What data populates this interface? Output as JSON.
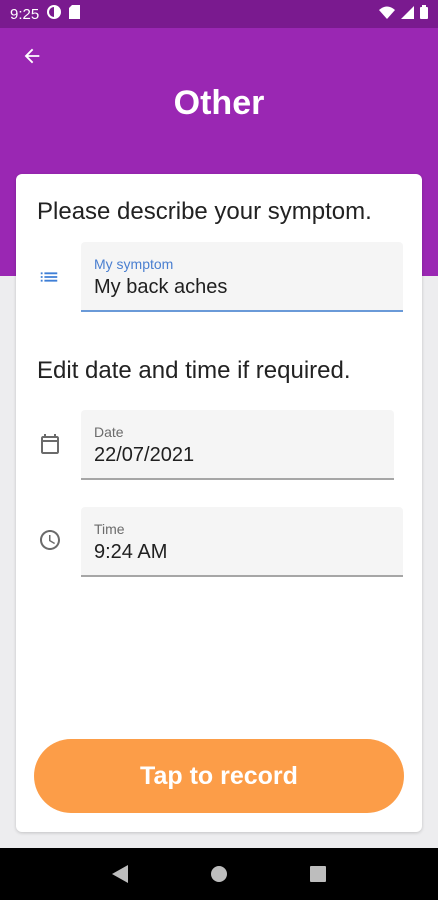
{
  "status_bar": {
    "time": "9:25",
    "icons": [
      "data-saver-icon",
      "sim-card-icon",
      "wifi-icon",
      "signal-icon",
      "battery-icon"
    ]
  },
  "header": {
    "title": "Other",
    "back_icon": "arrow-back-icon",
    "background_color": "#9a27b3"
  },
  "symptom_section": {
    "heading": "Please describe your symptom.",
    "field": {
      "label": "My symptom",
      "value": "My back aches",
      "icon": "list-icon"
    }
  },
  "datetime_section": {
    "heading": "Edit date and time if required.",
    "date_field": {
      "label": "Date",
      "value": "22/07/2021",
      "icon": "calendar-icon"
    },
    "time_field": {
      "label": "Time",
      "value": "9:24 AM",
      "icon": "clock-icon"
    }
  },
  "record_button": {
    "label": "Tap to record",
    "color": "#fc9d48"
  },
  "nav_bar": {
    "buttons": [
      "back-triangle-icon",
      "home-circle-icon",
      "recents-square-icon"
    ]
  }
}
